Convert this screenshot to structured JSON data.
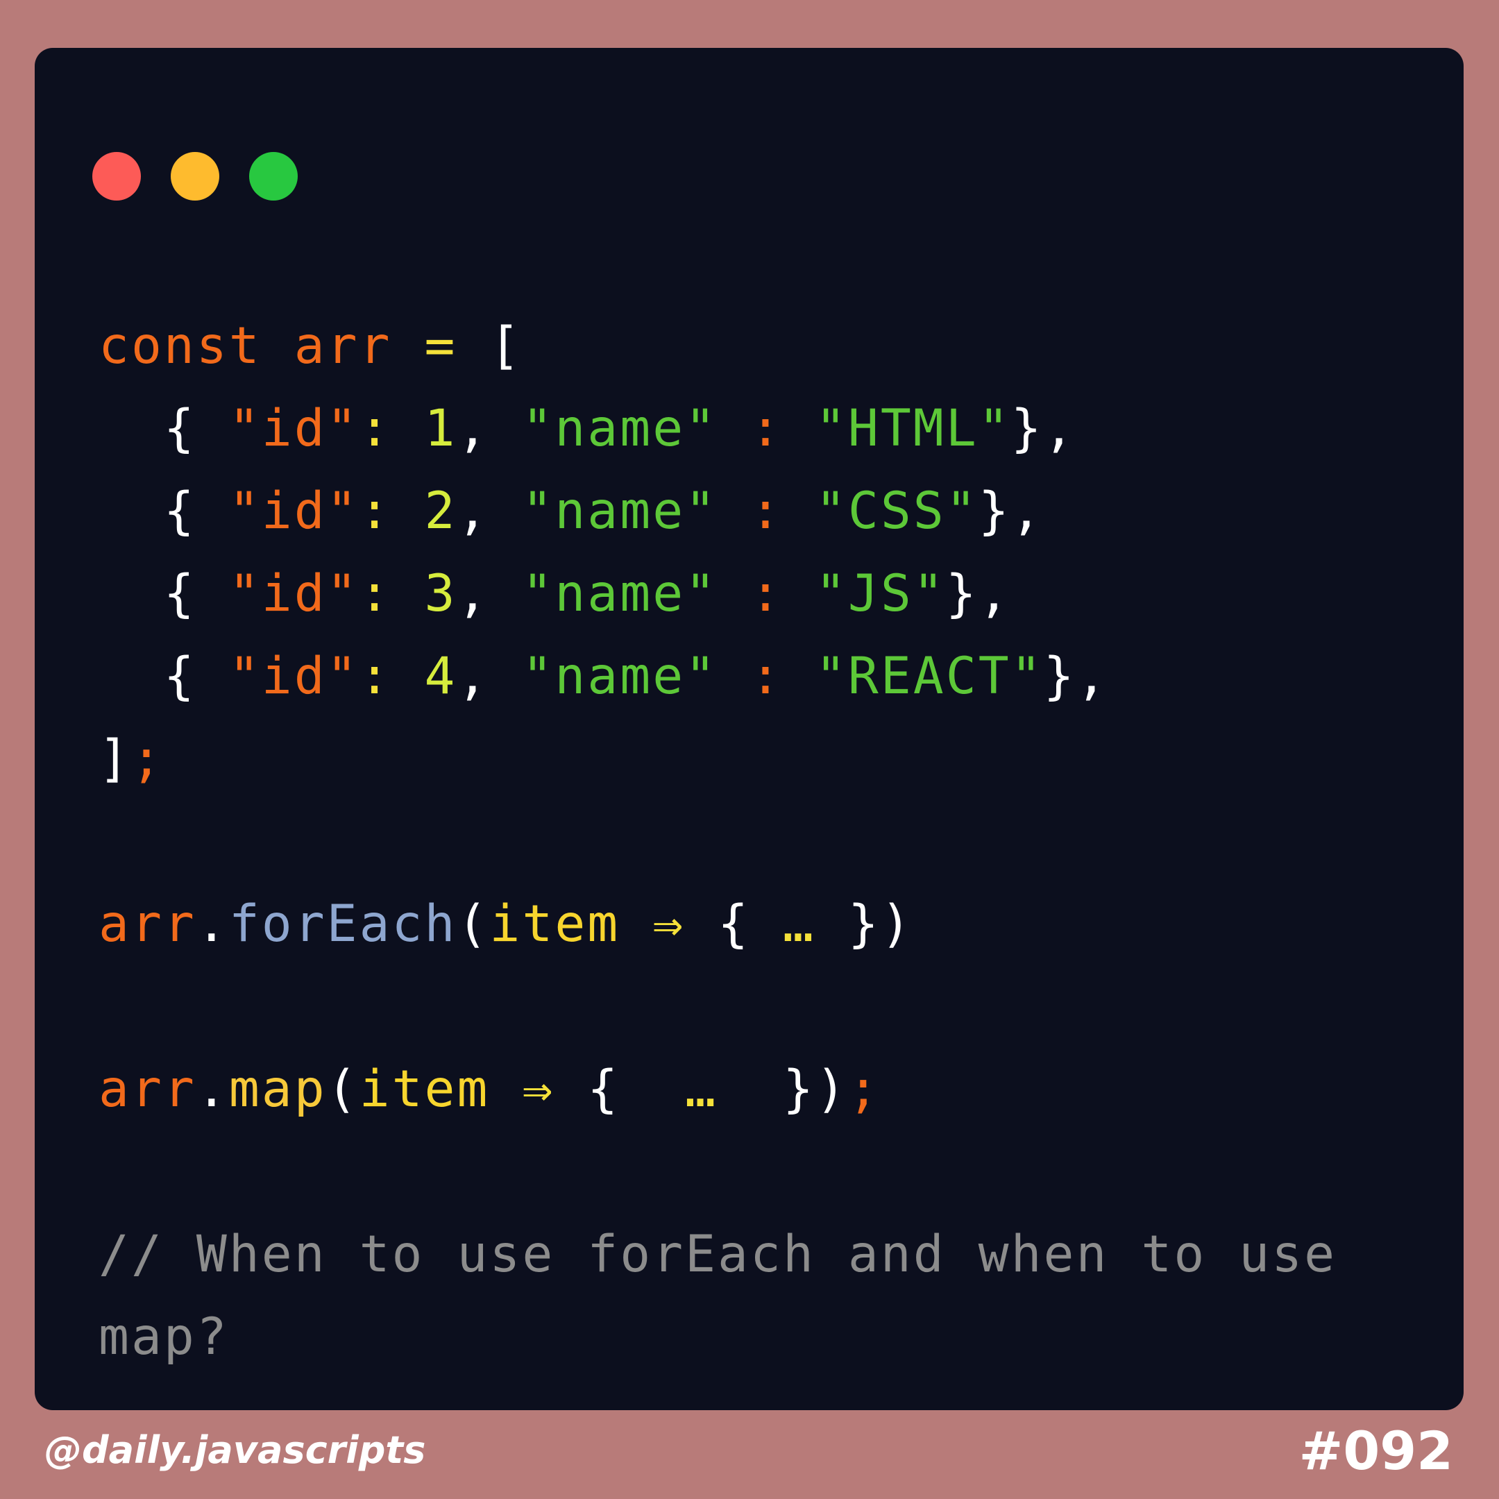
{
  "window_controls": {
    "close_color": "#fd5b57",
    "minimize_color": "#febb2e",
    "maximize_color": "#28c840"
  },
  "code": {
    "line1": {
      "kw": "const",
      "var": "arr",
      "op": "=",
      "open": "["
    },
    "rows": [
      {
        "id": "1",
        "name": "\"HTML\""
      },
      {
        "id": "2",
        "name": "\"CSS\""
      },
      {
        "id": "3",
        "name": "\"JS\""
      },
      {
        "id": "4",
        "name": "\"REACT\""
      }
    ],
    "row_parts": {
      "brace_open": "{",
      "id_key": "\"id\"",
      "colon": ":",
      "comma": ",",
      "name_key": "\"name\"",
      "name_colon": ":",
      "brace_close": "},"
    },
    "close_line": {
      "bracket": "]",
      "semi": ";"
    },
    "foreach_line": {
      "obj": "arr",
      "dot": ".",
      "method": "forEach",
      "open": "(",
      "param": "item",
      "arrow": "⇒",
      "body_open": "{",
      "ellipsis": "…",
      "body_close": "})"
    },
    "map_line": {
      "obj": "arr",
      "dot": ".",
      "method": "map",
      "open": "(",
      "param": "item",
      "arrow": "⇒",
      "body_open": "{",
      "ellipsis": "…",
      "body_close": "})",
      "semi": ";"
    },
    "comment_line1": "// When to use forEach and when to use",
    "comment_line2": "map?"
  },
  "footer": {
    "handle": "@daily.javascripts",
    "issue": "#092"
  }
}
